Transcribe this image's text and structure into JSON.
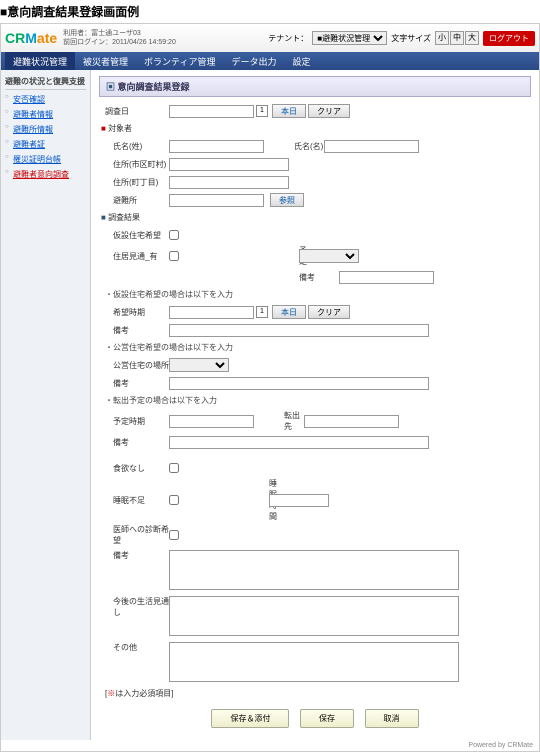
{
  "page_heading": "■意向調査結果登録画面例",
  "header": {
    "logo_text": "CRMate",
    "user_label": "利用者：",
    "user_name": "富士通ユーザ03",
    "login_label": "前回ログイン：",
    "login_time": "2011/04/26 14:59:20",
    "tenant_label": "テナント：",
    "tenant_value": "■避難状況管理",
    "fontsize_label": "文字サイズ",
    "fonts": [
      "小",
      "中",
      "大"
    ],
    "logout": "ログアウト"
  },
  "tabs": [
    "避難状況管理",
    "被災者管理",
    "ボランティア管理",
    "データ出力",
    "設定"
  ],
  "sidebar": {
    "title": "避難の状況と復興支援",
    "items": [
      "安否確認",
      "避難者情報",
      "避難所情報",
      "避難者証",
      "罹災証明台帳",
      "避難者意向調査"
    ]
  },
  "panel_title": "意向調査結果登録",
  "labels": {
    "survey_date": "調査日",
    "target": "対象者",
    "surname": "氏名(姓)",
    "given": "氏名(名)",
    "addr1": "住所(市区町村)",
    "addr2": "住所(町丁目)",
    "shelter": "避難所",
    "ref_btn": "参照",
    "today": "本日",
    "clear": "クリア",
    "results": "調査結果",
    "temp_housing": "仮設住宅希望",
    "resume_biz": "住居見通_有",
    "plan": "予定",
    "note": "備考",
    "temp_note": "・仮設住宅希望の場合は以下を入力",
    "wish_time": "希望時期",
    "public_note": "・公営住宅希望の場合は以下を入力",
    "public_loc": "公営住宅の場所",
    "move_note": "・転出予定の場合は以下を入力",
    "move_time": "予定時期",
    "move_dest": "転出先",
    "appetite": "食欲なし",
    "sleep_short": "睡眠不足",
    "sleep_time": "睡眠時間",
    "doctor": "医師への診断希望",
    "future": "今後の生活見通し",
    "other": "その他",
    "required_note_pre": "[",
    "required_note_mark": "※",
    "required_note_post": "は入力必須項目]",
    "save_attach": "保存＆添付",
    "save": "保存",
    "cancel": "取消"
  },
  "footer": "Powered by CRMate"
}
